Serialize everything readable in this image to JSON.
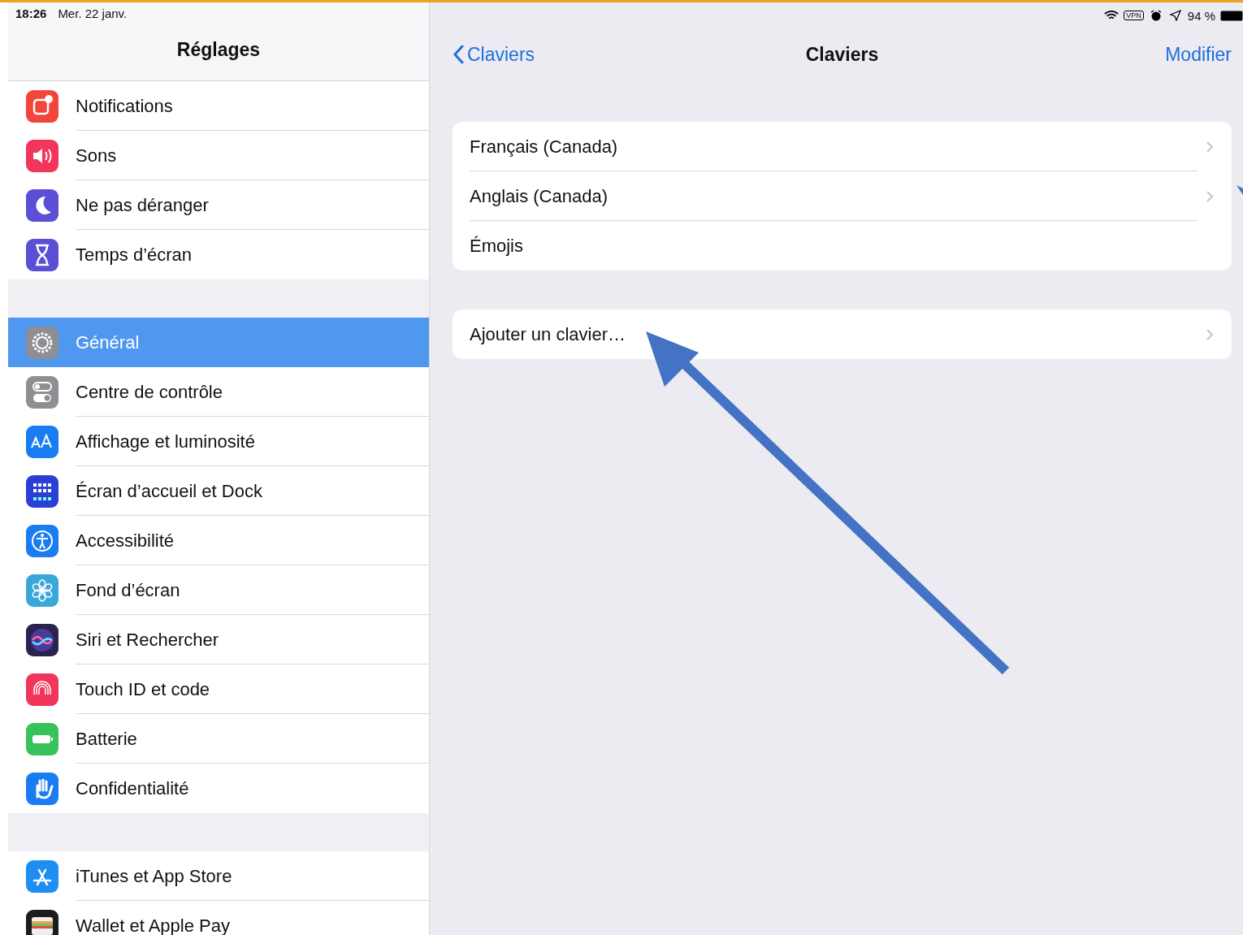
{
  "status_bar": {
    "time": "18:26",
    "date": "Mer. 22 janv.",
    "vpn": "VPN",
    "battery": "94 %"
  },
  "sidebar": {
    "title": "Réglages",
    "groups": [
      {
        "items": [
          {
            "label": "Notifications",
            "kind": "notifications",
            "color": "#f2463c",
            "selected": false
          },
          {
            "label": "Sons",
            "kind": "sounds",
            "color": "#f2355a",
            "selected": false
          },
          {
            "label": "Ne pas déranger",
            "kind": "moon",
            "color": "#5b4fd6",
            "selected": false
          },
          {
            "label": "Temps d’écran",
            "kind": "hourglass",
            "color": "#5b4fd6",
            "selected": false
          }
        ]
      },
      {
        "items": [
          {
            "label": "Général",
            "kind": "gear",
            "color": "#8e8e93",
            "selected": true
          },
          {
            "label": "Centre de contrôle",
            "kind": "toggles",
            "color": "#8e8e93",
            "selected": false
          },
          {
            "label": "Affichage et luminosité",
            "kind": "text-size",
            "color": "#1a7cf2",
            "selected": false
          },
          {
            "label": "Écran d’accueil et Dock",
            "kind": "grid",
            "color": "#2b3fd6",
            "selected": false
          },
          {
            "label": "Accessibilité",
            "kind": "accessibility",
            "color": "#1a7cf2",
            "selected": false
          },
          {
            "label": "Fond d’écran",
            "kind": "flower",
            "color": "#3aa7d9",
            "selected": false
          },
          {
            "label": "Siri et Rechercher",
            "kind": "siri",
            "color": "#2a2350",
            "selected": false
          },
          {
            "label": "Touch ID et code",
            "kind": "fingerprint",
            "color": "#f2355a",
            "selected": false
          },
          {
            "label": "Batterie",
            "kind": "battery",
            "color": "#38c25a",
            "selected": false
          },
          {
            "label": "Confidentialité",
            "kind": "hand",
            "color": "#1a7cf2",
            "selected": false
          }
        ]
      },
      {
        "items": [
          {
            "label": "iTunes et App Store",
            "kind": "appstore",
            "color": "#1f8ef2",
            "selected": false
          },
          {
            "label": "Wallet et Apple Pay",
            "kind": "wallet",
            "color": "#1c1c1e",
            "selected": false
          }
        ]
      }
    ]
  },
  "detail": {
    "back": "Claviers",
    "title": "Claviers",
    "action": "Modifier",
    "groups": [
      {
        "rows": [
          {
            "label": "Français (Canada)",
            "chevron": true
          },
          {
            "label": "Anglais (Canada)",
            "chevron": true
          },
          {
            "label": "Émojis",
            "chevron": false
          }
        ]
      },
      {
        "rows": [
          {
            "label": "Ajouter un clavier…",
            "chevron": true
          }
        ]
      }
    ]
  }
}
